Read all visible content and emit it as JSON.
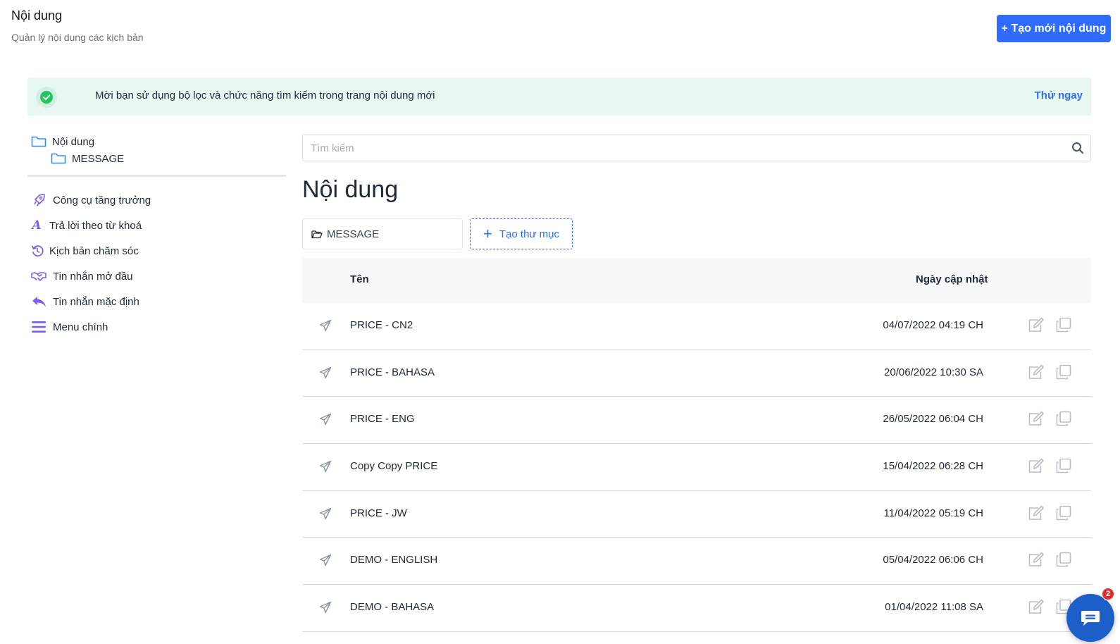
{
  "header": {
    "title": "Nội dung",
    "subtitle": "Quản lý nội dung các kịch bản",
    "create_button": "+ Tạo mới nội dung"
  },
  "notice": {
    "text": "Mời bạn sử dụng bộ lọc và chức năng tìm kiếm trong trang nội dung mới",
    "link": "Thử ngay"
  },
  "tree": {
    "root": "Nội dung",
    "child": "MESSAGE"
  },
  "menu": {
    "items": [
      {
        "label": "Công cụ tăng trưởng",
        "icon": "rocket-icon"
      },
      {
        "label": "Trả lời theo từ khoá",
        "icon": "letter-a-icon"
      },
      {
        "label": "Kịch bản chăm sóc",
        "icon": "history-icon"
      },
      {
        "label": "Tin nhắn mở đầu",
        "icon": "handshake-icon"
      },
      {
        "label": "Tin nhắn mặc định",
        "icon": "reply-icon"
      },
      {
        "label": "Menu chính",
        "icon": "menu-icon"
      }
    ]
  },
  "search": {
    "placeholder": "Tìm kiếm"
  },
  "main": {
    "title": "Nội dung",
    "folder_chip": "MESSAGE",
    "new_folder": "Tạo thư mục"
  },
  "table": {
    "columns": [
      "Tên",
      "Ngày cập nhật"
    ],
    "rows": [
      {
        "name": "PRICE - CN2",
        "date": "04/07/2022 04:19 CH"
      },
      {
        "name": "PRICE - BAHASA",
        "date": "20/06/2022 10:30 SA"
      },
      {
        "name": "PRICE - ENG",
        "date": "26/05/2022 06:04 CH"
      },
      {
        "name": "Copy Copy PRICE",
        "date": "15/04/2022 06:28 CH"
      },
      {
        "name": "PRICE - JW",
        "date": "11/04/2022 05:19 CH"
      },
      {
        "name": "DEMO - ENGLISH",
        "date": "05/04/2022 06:06 CH"
      },
      {
        "name": "DEMO - BAHASA",
        "date": "01/04/2022 11:08 SA"
      }
    ]
  },
  "chat": {
    "badge": "2"
  },
  "colors": {
    "accent": "#2f6bff",
    "notice_bg": "#e8f8f1",
    "success": "#22c55e",
    "menu_icon": "#7c5cf5",
    "chat": "#1c5fc9"
  }
}
